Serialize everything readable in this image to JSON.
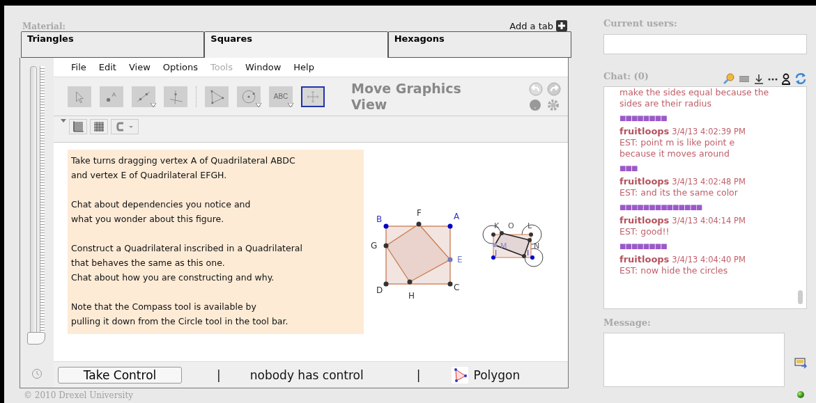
{
  "material": {
    "label": "Material:",
    "add_tab": "Add a tab",
    "tabs": [
      {
        "label": "Triangles",
        "selected": false
      },
      {
        "label": "Squares",
        "selected": true
      },
      {
        "label": "Hexagons",
        "selected": false
      }
    ],
    "slider": {
      "level": 0
    },
    "menu": [
      {
        "label": "File",
        "disabled": false
      },
      {
        "label": "Edit",
        "disabled": false
      },
      {
        "label": "View",
        "disabled": false
      },
      {
        "label": "Options",
        "disabled": false
      },
      {
        "label": "Tools",
        "disabled": true
      },
      {
        "label": "Window",
        "disabled": false
      },
      {
        "label": "Help",
        "disabled": false
      }
    ],
    "tools": [
      {
        "kind": "move",
        "selected": false,
        "dropdown": false
      },
      {
        "kind": "point",
        "selected": false,
        "dropdown": false
      },
      {
        "kind": "line",
        "selected": false,
        "dropdown": true
      },
      {
        "kind": "perpendicular",
        "selected": false,
        "dropdown": false
      },
      {
        "kind": "polygon",
        "selected": false,
        "dropdown": false
      },
      {
        "kind": "circle",
        "selected": false,
        "dropdown": true
      },
      {
        "kind": "text",
        "label": "ABC",
        "selected": false,
        "dropdown": true
      },
      {
        "kind": "move-view",
        "selected": true,
        "dropdown": false
      }
    ],
    "tool_name": "Move Graphics View",
    "instructions": [
      [
        "Take turns dragging vertex A of Quadrilateral ABDC",
        "and vertex E of Quadrilateral EFGH."
      ],
      [
        "Chat about dependencies you notice and",
        "what you wonder about this figure."
      ],
      [
        "Construct a Quadrilateral inscribed in a Quadrilateral",
        "that behaves the same as this one.",
        "Chat about how you are constructing and why."
      ],
      [
        "Note that the Compass tool is available by",
        "pulling it down from the Circle tool in the tool bar."
      ]
    ],
    "figure": {
      "labels": [
        "B",
        "F",
        "A",
        "G",
        "E",
        "D",
        "H",
        "C"
      ],
      "small_labels": [
        "K",
        "O",
        "L",
        "M",
        "N",
        "J",
        "I"
      ]
    },
    "control": {
      "button": "Take Control",
      "separator_1": "|",
      "status": "nobody has control",
      "separator_2": "|",
      "tool": "Polygon"
    },
    "footer": "© 2010 Drexel University"
  },
  "users": {
    "label": "Current users:"
  },
  "chat": {
    "label": "Chat: (0)",
    "messages": [
      {
        "kind": "text",
        "text": "make the sides equal because the sides are their radius"
      },
      {
        "kind": "typing",
        "marks": "■■■■■■■■"
      },
      {
        "kind": "post",
        "author": "fruitloops",
        "time": "3/4/13 4:02:39 PM",
        "text": "EST: point m is like point e because it moves around"
      },
      {
        "kind": "typing",
        "marks": "■■■"
      },
      {
        "kind": "post",
        "author": "fruitloops",
        "time": "3/4/13 4:02:48 PM",
        "text": "EST: and its the same color"
      },
      {
        "kind": "typing",
        "marks": "■■■■■■■■■■■■■■"
      },
      {
        "kind": "post",
        "author": "fruitloops",
        "time": "3/4/13 4:04:14 PM",
        "text": "EST: good!!"
      },
      {
        "kind": "typing",
        "marks": "■■■■■■■■"
      },
      {
        "kind": "post",
        "author": "fruitloops",
        "time": "3/4/13 4:04:40 PM",
        "text": "EST: now hide the circles"
      }
    ]
  },
  "message": {
    "label": "Message:"
  }
}
